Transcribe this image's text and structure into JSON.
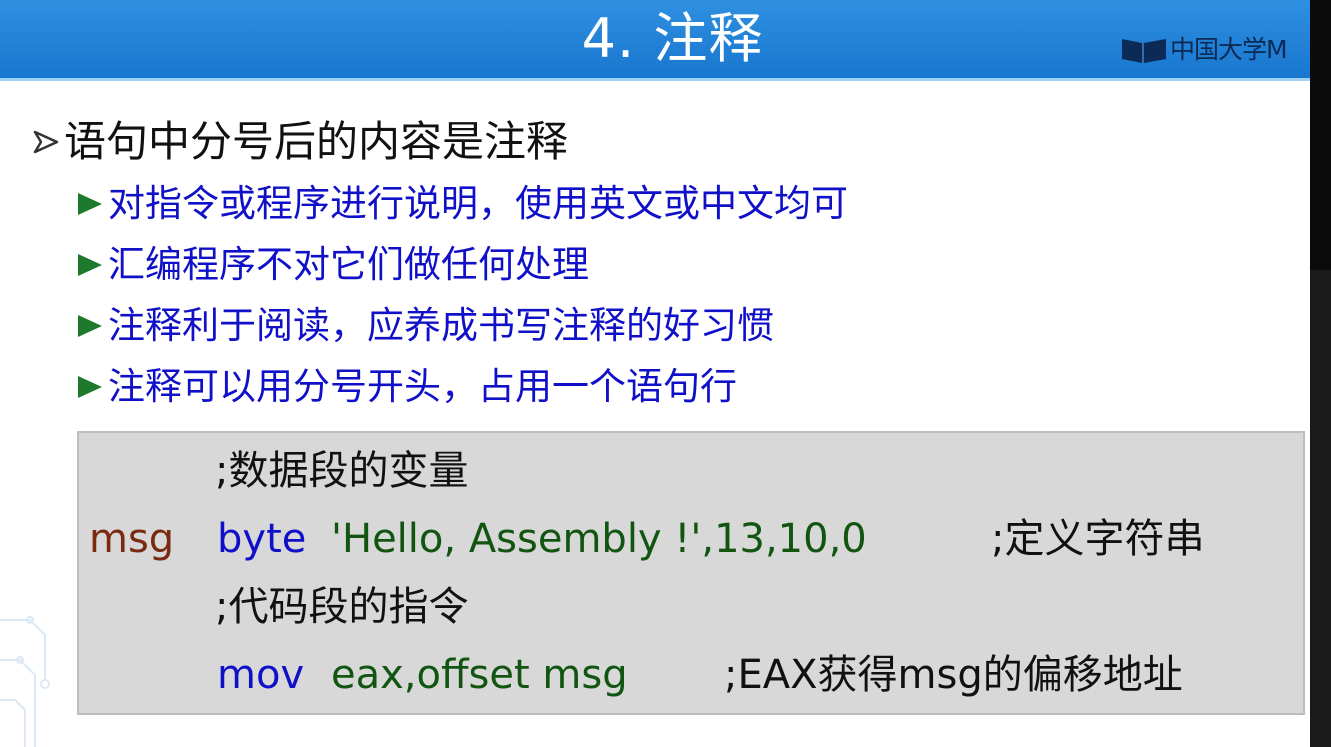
{
  "header": {
    "title": "4. 注释",
    "logo_text": "中国大学M",
    "background": "#1a7fd6"
  },
  "main_bullet": "语句中分号后的内容是注释",
  "sub_bullets": [
    "对指令或程序进行说明，使用英文或中文均可",
    "汇编程序不对它们做任何处理",
    "注释利于阅读，应养成书写注释的好习惯",
    "注释可以用分号开头，占用一个语句行"
  ],
  "code": {
    "line1_comment": ";数据段的变量",
    "line2_label": "msg",
    "line2_keyword": "byte",
    "line2_operand": "'Hello, Assembly !',13,10,0",
    "line2_comment": ";定义字符串",
    "line3_comment": ";代码段的指令",
    "line4_keyword": "mov",
    "line4_operand": "eax,offset msg",
    "line4_comment": ";EAX获得msg的偏移地址"
  },
  "colors": {
    "sub_text": "#1010c8",
    "bullet_triangle": "#1d7a2c",
    "code_label": "#7a2a10",
    "code_keyword": "#1010c8",
    "code_operand": "#115511"
  }
}
